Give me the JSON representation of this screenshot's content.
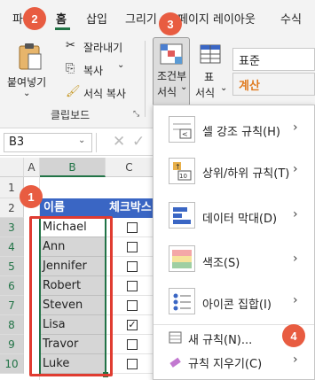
{
  "ribbon": {
    "tabs": [
      "파",
      "홈",
      "삽입",
      "그리기",
      "페이지 레이아웃",
      "수식"
    ],
    "clipboard": {
      "paste_label": "붙여넣기",
      "cut_label": "잘라내기",
      "copy_label": "복사",
      "format_painter_label": "서식 복사",
      "group_label": "클립보드"
    },
    "styles": {
      "conditional_format_line1": "조건부",
      "conditional_format_line2": "서식",
      "table_format_line1": "표",
      "table_format_line2": "서식",
      "number_format_value": "표준",
      "calc_style_value": "계산"
    }
  },
  "formula_bar": {
    "name_box": "B3"
  },
  "columns": [
    "A",
    "B",
    "C"
  ],
  "rows": [
    "1",
    "2",
    "3",
    "4",
    "5",
    "6",
    "7",
    "8",
    "9",
    "10"
  ],
  "table": {
    "header_name": "이름",
    "header_check": "체크박스",
    "names": [
      "Michael",
      "Ann",
      "Jennifer",
      "Robert",
      "Steven",
      "Lisa",
      "Travor",
      "Luke"
    ],
    "checked": [
      false,
      false,
      false,
      false,
      false,
      true,
      false,
      false
    ]
  },
  "menu": {
    "items": [
      {
        "label": "셀 강조 규칙(H)",
        "icon": "highlight-cells-rules-icon"
      },
      {
        "label": "상위/하위 규칙(T)",
        "icon": "top-bottom-rules-icon"
      },
      {
        "label": "데이터 막대(D)",
        "icon": "data-bars-icon"
      },
      {
        "label": "색조(S)",
        "icon": "color-scales-icon"
      },
      {
        "label": "아이콘 집합(I)",
        "icon": "icon-sets-icon"
      }
    ],
    "new_rule": "새 규칙(N)...",
    "clear_rules": "규칙 지우기(C)"
  },
  "badges": [
    "1",
    "2",
    "3",
    "4"
  ],
  "colors": {
    "accent_green": "#217346",
    "header_blue": "#3a66c4",
    "badge_red": "#e85c41",
    "highlight_red": "#e03c31"
  }
}
